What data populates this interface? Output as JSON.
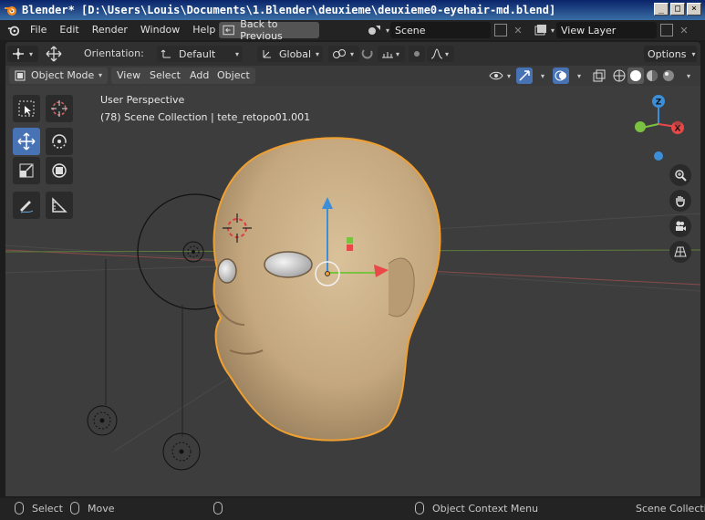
{
  "window": {
    "title": "Blender* [D:\\Users\\Louis\\Documents\\1.Blender\\deuxieme\\deuxieme0-eyehair-md.blend]",
    "controls": [
      "_",
      "□",
      "×"
    ]
  },
  "menubar": {
    "items": [
      "File",
      "Edit",
      "Render",
      "Window",
      "Help"
    ],
    "back_button": "Back to Previous",
    "scene": "Scene",
    "view_layer": "View Layer"
  },
  "toolheader": {
    "orientation_label": "Orientation:",
    "orientation_value": "Default",
    "transform_orientation": "Global",
    "options_label": "Options"
  },
  "vpheader": {
    "mode": "Object Mode",
    "menus": [
      "View",
      "Select",
      "Add",
      "Object"
    ]
  },
  "viewport": {
    "perspective": "User Perspective",
    "collection_info": "(78) Scene Collection | tete_retopo01.001",
    "gizmo_axes": [
      "Z",
      "X",
      "Y"
    ]
  },
  "tools": [
    "select-box",
    "cursor",
    "move",
    "rotate",
    "scale",
    "transform",
    "annotate",
    "measure"
  ],
  "statusbar": {
    "select": "Select",
    "move": "Move",
    "context_menu": "Object Context Menu",
    "right_text": "Scene Collectio"
  },
  "colors": {
    "accent": "#4772b3",
    "selection_outline": "#f0a030",
    "x_axis": "#e84848",
    "y_axis": "#7cc242",
    "z_axis": "#3d8ed8",
    "skin": "#c8ad86"
  }
}
